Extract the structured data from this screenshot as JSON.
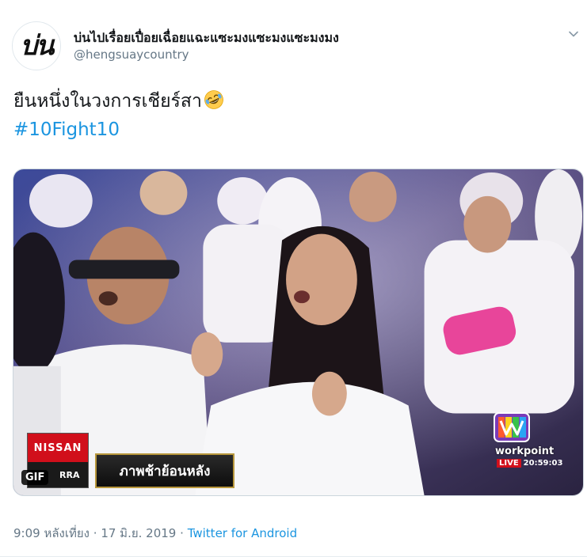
{
  "author": {
    "avatar_text": "บ่น",
    "display_name": "บ่นไปเรื่อยเปื่อยเฉื่อยแฉะแซะมงแซะมงแซะมงมง",
    "handle": "@hengsuaycountry"
  },
  "menu_icon": "chevron-down-icon",
  "tweet": {
    "text": "ยืนหนึ่งในวงการเชียร์สา",
    "emoji": "rolling-on-floor-laughing-emoji",
    "hashtag": "#10Fight10"
  },
  "media": {
    "type": "GIF",
    "gif_label": "GIF",
    "sponsor_name": "NISSAN",
    "sponsor_sub": "RRA",
    "caption": "ภาพช้าย้อนหลัง",
    "channel_name": "workpoint",
    "live_label": "LIVE",
    "live_clock": "20:59:03"
  },
  "footer": {
    "time": "9:09 หลังเที่ยง",
    "separator": "·",
    "date": "17 มิ.ย. 2019",
    "source": "Twitter for Android"
  },
  "colors": {
    "link": "#1b95e0",
    "secondary_text": "#657786",
    "primary_text": "#14171a",
    "sponsor_red": "#d10f1b"
  }
}
